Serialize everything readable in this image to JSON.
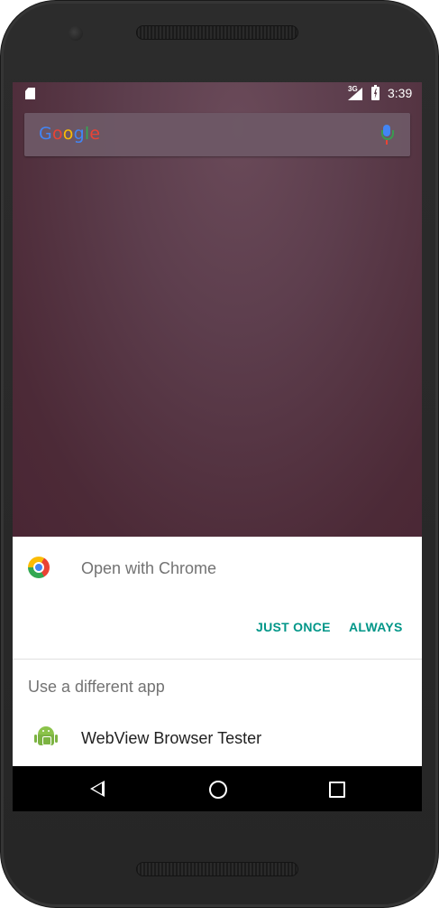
{
  "status_bar": {
    "network_label": "3G",
    "time": "3:39",
    "icons": [
      "sd-card-icon",
      "signal-icon",
      "battery-charging-icon"
    ]
  },
  "search_widget": {
    "logo_letters": [
      {
        "char": "G",
        "color": "#4285f4"
      },
      {
        "char": "o",
        "color": "#ea4335"
      },
      {
        "char": "o",
        "color": "#fbbc05"
      },
      {
        "char": "g",
        "color": "#4285f4"
      },
      {
        "char": "l",
        "color": "#34a853"
      },
      {
        "char": "e",
        "color": "#ea4335"
      }
    ],
    "mic_icon": "microphone-icon"
  },
  "chooser": {
    "title": "Open with Chrome",
    "title_icon": "chrome-icon",
    "just_once_label": "JUST ONCE",
    "always_label": "ALWAYS",
    "alternatives_heading": "Use a different app",
    "apps": [
      {
        "label": "WebView Browser Tester",
        "icon": "android-app-icon"
      }
    ],
    "accent_color": "#009688"
  },
  "nav_bar": {
    "icons": [
      "back-icon",
      "home-icon",
      "recents-icon"
    ]
  }
}
